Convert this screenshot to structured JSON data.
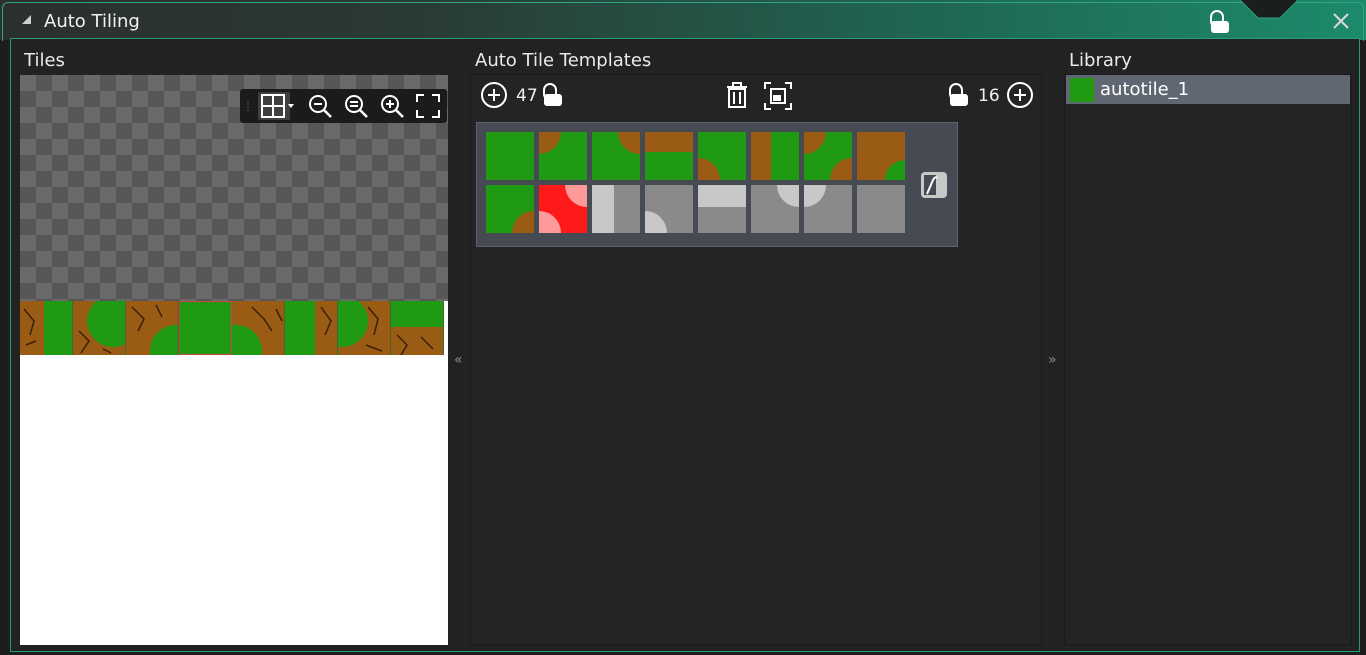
{
  "window": {
    "title": "Auto Tiling"
  },
  "tiles_panel": {
    "title": "Tiles"
  },
  "templates_panel": {
    "title": "Auto Tile Templates",
    "left_count": "47",
    "right_count": "16"
  },
  "library_panel": {
    "title": "Library",
    "items": [
      {
        "label": "autotile_1"
      }
    ]
  },
  "splitters": {
    "left": "«",
    "right": "»"
  },
  "colors": {
    "accent": "#2a9b79",
    "selected_template": "#ff1a1a",
    "grass": "#1f9a12",
    "dirt": "#9a5b14"
  },
  "icons": [
    "lock-icon",
    "close-icon",
    "grid-icon",
    "zoom-out-icon",
    "zoom-reset-icon",
    "zoom-in-icon",
    "fit-icon",
    "add-icon",
    "trash-icon",
    "select-icon"
  ]
}
